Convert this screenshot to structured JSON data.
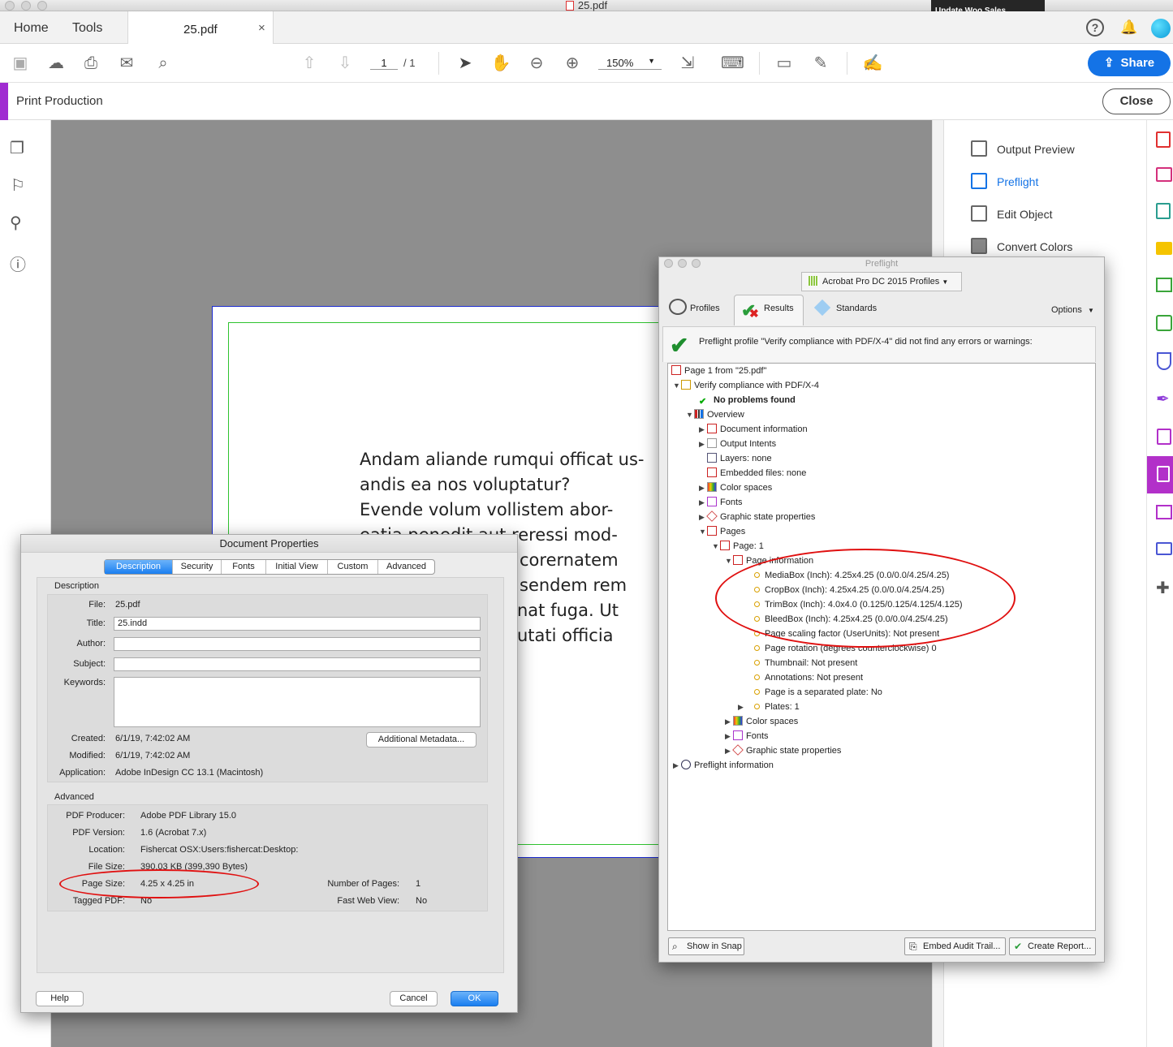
{
  "window": {
    "title": "25.pdf",
    "notification": "Update Woo Sales"
  },
  "tabs": {
    "home": "Home",
    "tools": "Tools",
    "document": "25.pdf"
  },
  "toolbar": {
    "page_current": "1",
    "page_total": "/ 1",
    "zoom": "150%",
    "share": "Share"
  },
  "print_production": {
    "title": "Print Production",
    "close": "Close"
  },
  "right_panel": {
    "items": [
      "Output Preview",
      "Preflight",
      "Edit Object",
      "Convert Colors"
    ],
    "active_color": "#1473e6"
  },
  "pdf_text": [
    "Andam aliande rumqui officat us-",
    "andis ea nos voluptatur?",
    "Evende volum vollistem abor-",
    "eatia penedit aut reressi mod-",
    "corernatem",
    "sendem rem",
    "nat fuga. Ut",
    "utati officia"
  ],
  "preflight": {
    "title": "Preflight",
    "profile_dropdown": "Acrobat Pro DC 2015 Profiles",
    "tabs": {
      "profiles": "Profiles",
      "results": "Results",
      "standards": "Standards",
      "options": "Options"
    },
    "message": "Preflight profile \"Verify compliance with PDF/X-4\" did not find any errors or warnings:",
    "tree": [
      "Page 1 from \"25.pdf\"",
      "Verify compliance with PDF/X-4",
      "No problems found",
      "Overview",
      "Document information",
      "Output Intents",
      "Layers: none",
      "Embedded files: none",
      "Color spaces",
      "Fonts",
      "Graphic state properties",
      "Pages",
      "Page: 1",
      "Page information",
      "MediaBox (Inch): 4.25x4.25 (0.0/0.0/4.25/4.25)",
      "CropBox (Inch): 4.25x4.25 (0.0/0.0/4.25/4.25)",
      "TrimBox (Inch): 4.0x4.0 (0.125/0.125/4.125/4.125)",
      "BleedBox (Inch): 4.25x4.25 (0.0/0.0/4.25/4.25)",
      "Page scaling factor (UserUnits): Not present",
      "Page rotation (degrees counterclockwise) 0",
      "Thumbnail: Not present",
      "Annotations: Not present",
      "Page is a separated plate: No",
      "Plates: 1",
      "Color spaces",
      "Fonts",
      "Graphic state properties",
      "Preflight information"
    ],
    "buttons": {
      "snap": "Show in Snap",
      "embed": "Embed Audit Trail...",
      "report": "Create Report..."
    }
  },
  "doc_props": {
    "title": "Document Properties",
    "tabs": [
      "Description",
      "Security",
      "Fonts",
      "Initial View",
      "Custom",
      "Advanced"
    ],
    "description_header": "Description",
    "labels": {
      "file": "File:",
      "title": "Title:",
      "author": "Author:",
      "subject": "Subject:",
      "keywords": "Keywords:",
      "created": "Created:",
      "modified": "Modified:",
      "application": "Application:"
    },
    "file": "25.pdf",
    "title_value": "25.indd",
    "author": "",
    "subject": "",
    "created": "6/1/19, 7:42:02 AM",
    "modified": "6/1/19, 7:42:02 AM",
    "application": "Adobe InDesign CC 13.1 (Macintosh)",
    "additional_metadata": "Additional Metadata...",
    "advanced_header": "Advanced",
    "adv_labels": {
      "producer": "PDF Producer:",
      "version": "PDF Version:",
      "location": "Location:",
      "file_size": "File Size:",
      "page_size": "Page Size:",
      "tagged": "Tagged PDF:",
      "num_pages": "Number of Pages:",
      "fast_web": "Fast Web View:"
    },
    "producer": "Adobe PDF Library 15.0",
    "version": "1.6 (Acrobat 7.x)",
    "location": "Fishercat OSX:Users:fishercat:Desktop:",
    "file_size": "390.03 KB (399,390 Bytes)",
    "page_size": "4.25 x 4.25 in",
    "tagged": "No",
    "num_pages": "1",
    "fast_web": "No",
    "buttons": {
      "help": "Help",
      "cancel": "Cancel",
      "ok": "OK"
    }
  }
}
